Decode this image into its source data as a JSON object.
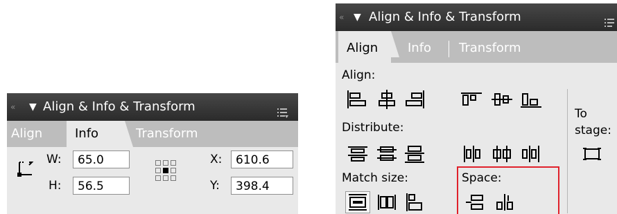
{
  "left_panel": {
    "title": "Align & Info & Transform",
    "tabs": [
      {
        "label": "Align",
        "active": false
      },
      {
        "label": "Info",
        "active": true
      },
      {
        "label": "Transform",
        "active": false
      }
    ],
    "w_label": "W:",
    "w_value": "65.0",
    "h_label": "H:",
    "h_value": "56.5",
    "x_label": "X:",
    "x_value": "610.6",
    "y_label": "Y:",
    "y_value": "398.4"
  },
  "right_panel": {
    "title": "Align & Info & Transform",
    "tabs": [
      {
        "label": "Align",
        "active": true
      },
      {
        "label": "Info",
        "active": false
      },
      {
        "label": "Transform",
        "active": false
      }
    ],
    "align_label": "Align:",
    "distribute_label": "Distribute:",
    "match_size_label": "Match size:",
    "space_label": "Space:",
    "to_label": "To",
    "stage_label": "stage:"
  },
  "colors": {
    "titlebar": "#333333",
    "tab_strip": "#bdbdbd",
    "body": "#e9e9e9",
    "highlight_border": "#e0202a"
  }
}
